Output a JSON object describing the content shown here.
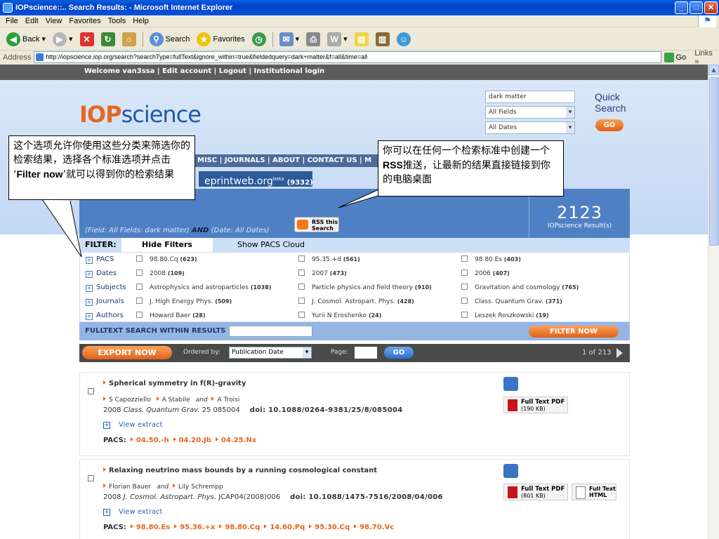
{
  "window": {
    "title": "IOPscience::.. Search Results: - Microsoft Internet Explorer"
  },
  "menu": [
    "File",
    "Edit",
    "View",
    "Favorites",
    "Tools",
    "Help"
  ],
  "toolbar": {
    "back": "Back",
    "search": "Search",
    "favorites": "Favorites"
  },
  "address": {
    "label": "Address",
    "url": "http://iopscience.iop.org/search?searchType=fullText&ignore_within=true&fieldedquery=dark+matter&f=all&time=all",
    "go": "Go",
    "links": "Links"
  },
  "topbar": {
    "welcome": "Welcome van3ssa | Edit account | Logout | Institutional login"
  },
  "logo": {
    "iop": "IOP",
    "science": "science"
  },
  "search": {
    "query": "dark matter",
    "field": "All Fields",
    "dates": "All Dates",
    "quick": "Quick",
    "search": "Search",
    "go": "GO"
  },
  "nav": {
    "items": "MISC | JOURNALS | ABOUT | CONTACT US | M"
  },
  "eprint": {
    "name": "eprintweb.org",
    "beta": "beta",
    "count": "(9332)"
  },
  "results": {
    "field_prefix": "(Field: All Fields: dark matter)",
    "and": "AND",
    "date_part": "(Date: All Dates)",
    "rss": "RSS this Search",
    "count": "2123",
    "count_label": "IOPscience Result(s)"
  },
  "filter": {
    "label": "FILTER:",
    "hide": "Hide Filters",
    "pacs_cloud": "Show PACS Cloud"
  },
  "filter_rows": [
    {
      "cat": "PACS",
      "opts": [
        {
          "t": "98.80.Cq",
          "n": "(623)"
        },
        {
          "t": "95.35.+d",
          "n": "(561)"
        },
        {
          "t": "98.80.Es",
          "n": "(403)"
        }
      ]
    },
    {
      "cat": "Dates",
      "opts": [
        {
          "t": "2008",
          "n": "(109)"
        },
        {
          "t": "2007",
          "n": "(473)"
        },
        {
          "t": "2006",
          "n": "(407)"
        }
      ]
    },
    {
      "cat": "Subjects",
      "opts": [
        {
          "t": "Astrophysics and astroparticles",
          "n": "(1038)"
        },
        {
          "t": "Particle physics and field theory",
          "n": "(910)"
        },
        {
          "t": "Gravitation and cosmology",
          "n": "(765)"
        }
      ]
    },
    {
      "cat": "Journals",
      "opts": [
        {
          "t": "J. High Energy Phys.",
          "n": "(509)"
        },
        {
          "t": "J. Cosmol. Astropart. Phys.",
          "n": "(428)"
        },
        {
          "t": "Class. Quantum Grav.",
          "n": "(371)"
        }
      ]
    },
    {
      "cat": "Authors",
      "opts": [
        {
          "t": "Howard Baer",
          "n": "(28)"
        },
        {
          "t": "Yurii N Eroshenko",
          "n": "(24)"
        },
        {
          "t": "Leszek Roszkowski",
          "n": "(19)"
        }
      ]
    }
  ],
  "fulltext": {
    "label": "FULLTEXT SEARCH WITHIN RESULTS",
    "filter_now": "FILTER NOW"
  },
  "export": {
    "label": "EXPORT NOW",
    "ordered_by": "Ordered by:",
    "order_value": "Publication Date",
    "page": "Page:",
    "go": "GO",
    "of": "1 of 213"
  },
  "items": [
    {
      "title": "Spherical symmetry in f(R)-gravity",
      "authors": [
        "S Capozziello",
        "A Stabile"
      ],
      "and_author": "A Troisi",
      "and": "and",
      "year": "2008",
      "journal": "Class. Quantum Grav.",
      "volume": "25",
      "article": "085004",
      "doi": "doi: 10.1088/0264-9381/25/8/085004",
      "view": "View extract",
      "pacs_label": "PACS:",
      "pacs": [
        "04.50.-h",
        "04.20.Jb",
        "04.25.Nx"
      ],
      "pdf": "Full Text PDF",
      "pdf_size": "(190 KB)"
    },
    {
      "title": "Relaxing neutrino mass bounds by a running cosmological constant",
      "authors": [
        "Florian Bauer"
      ],
      "and_author": "Lily Schrempp",
      "and": "and",
      "year": "2008",
      "journal": "J. Cosmol. Astropart. Phys.",
      "volume": "",
      "article": "JCAP04(2008)006",
      "doi": "doi: 10.1088/1475-7516/2008/04/006",
      "view": "View extract",
      "pacs_label": "PACS:",
      "pacs": [
        "98.80.Es",
        "95.36.+x",
        "98.80.Cq",
        "14.60.Pq",
        "95.30.Cq",
        "98.70.Vc"
      ],
      "pdf": "Full Text PDF",
      "pdf_size": "(801 KB)",
      "html": "Full Text HTML"
    }
  ],
  "callouts": {
    "left_1": "这个选项允许你使用这些分类来筛选你的检索结果，选择各个标准选项并点击 ‘",
    "left_bold": "Filter now",
    "left_2": "’就可以得到你的检索结果",
    "right_1": "你可以在任何一个检索标准中创建一个",
    "right_bold": "RSS",
    "right_2": "推送，让最新的结果直接链接到你的电脑桌面"
  },
  "colors": {
    "accent": "#e8671b",
    "nav": "#4d6b9a",
    "header": "#4f80c4"
  }
}
